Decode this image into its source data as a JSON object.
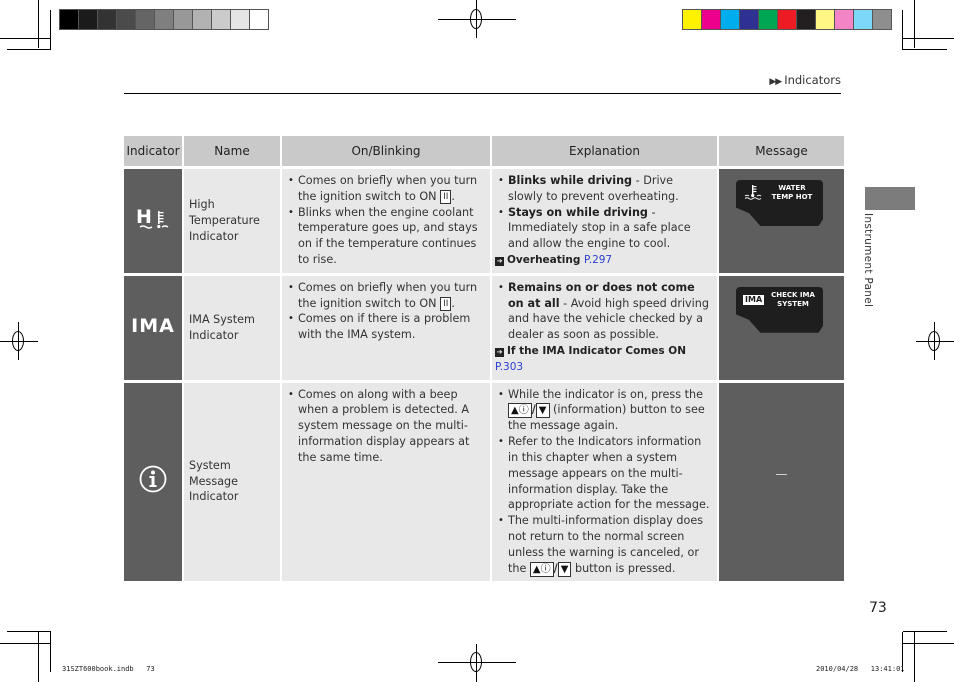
{
  "print_marks": {
    "grayscale_swatches": [
      "#000000",
      "#1b1b1b",
      "#333333",
      "#4b4b4b",
      "#656565",
      "#7f7f7f",
      "#989898",
      "#b2b2b2",
      "#cbcbcb",
      "#e5e5e5",
      "#ffffff"
    ],
    "color_swatches": [
      "#fff200",
      "#ec008c",
      "#00aeef",
      "#2e3192",
      "#00a651",
      "#ed1c24",
      "#231f20",
      "#fff685",
      "#f384c6",
      "#7dd7f9",
      "#8e8e8e"
    ]
  },
  "header": {
    "breadcrumb_arrows": "▶▶",
    "breadcrumb": "Indicators"
  },
  "table": {
    "columns": [
      "Indicator",
      "Name",
      "On/Blinking",
      "Explanation",
      "Message"
    ],
    "rows": [
      {
        "indicator_icon": "high-temperature-icon",
        "indicator_glyph": "H",
        "name": "High Temperature Indicator",
        "on_blinking": [
          {
            "text": "Comes on briefly when you turn the ignition switch to ON ",
            "key": "II",
            "after": "."
          },
          {
            "text": "Blinks when the engine coolant temperature goes up, and stays on if the temperature continues to rise."
          }
        ],
        "explanation": [
          {
            "term": "Blinks while driving",
            "text": " - Drive slowly to prevent overheating."
          },
          {
            "term": "Stays on while driving",
            "text": " - Immediately stop in a safe place and allow the engine to cool."
          }
        ],
        "reference": {
          "label": "Overheating",
          "page": "P.297"
        },
        "message": {
          "icon": "water-temp-icon",
          "lines": [
            "WATER",
            "TEMP HOT"
          ]
        }
      },
      {
        "indicator_icon": "ima-icon",
        "indicator_glyph": "IMA",
        "name": "IMA System Indicator",
        "on_blinking": [
          {
            "text": "Comes on briefly when you turn the ignition switch to ON ",
            "key": "II",
            "after": "."
          },
          {
            "text": "Comes on if there is a problem with the IMA system."
          }
        ],
        "explanation": [
          {
            "term": "Remains on or does not come on at all",
            "text": " - Avoid high speed driving and have the vehicle checked by a dealer as soon as possible."
          }
        ],
        "reference": {
          "label": "If the IMA Indicator Comes ON",
          "page": "P.303"
        },
        "message": {
          "icon": "ima-badge",
          "badge": "IMA",
          "lines": [
            "CHECK IMA",
            "SYSTEM"
          ]
        }
      },
      {
        "indicator_icon": "info-icon",
        "indicator_glyph": "i",
        "name": "System Message Indicator",
        "on_blinking": [
          {
            "text": "Comes on along with a beep when a problem is detected. A system message on the multi-information display appears at the same time."
          }
        ],
        "explanation": [
          {
            "before": "While the indicator is on, press the ",
            "btn_up": "▲ⓘ",
            "slash": "/",
            "btn_down": "▼",
            "after": " (information) button to see the message again."
          },
          {
            "text": "Refer to the Indicators information in this chapter when a system message appears on the multi-information display. Take the appropriate action for the message."
          },
          {
            "before": "The multi-information display does not return to the normal screen unless the warning is canceled, or the ",
            "btn_up": "▲ⓘ",
            "slash": "/",
            "btn_down": "▼",
            "after": " button is pressed."
          }
        ],
        "message": {
          "text": "—"
        }
      }
    ]
  },
  "side_tab": {
    "label": "Instrument Panel"
  },
  "page_number": "73",
  "footer": {
    "left": "31SZT600book.indb   73",
    "right": "2010/04/28   13:41:01"
  }
}
